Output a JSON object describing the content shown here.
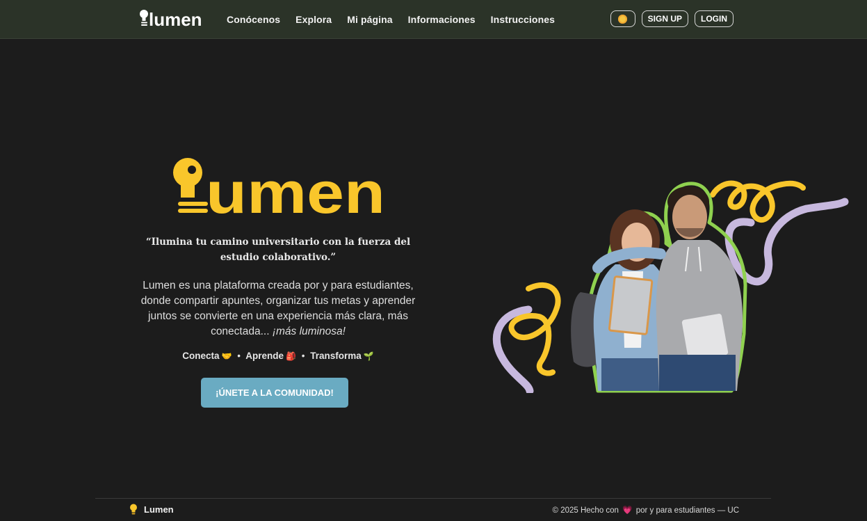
{
  "brand": {
    "name": "lumen",
    "accent": "#f9c62b"
  },
  "nav": {
    "links": [
      "Conócenos",
      "Explora",
      "Mi página",
      "Informaciones",
      "Instrucciones"
    ],
    "theme_icon": "sun-icon",
    "signup_label": "SIGN UP",
    "login_label": "LOGIN"
  },
  "hero": {
    "quote": "“Ilumina tu camino universitario con la fuerza del estudio colaborativo.”",
    "description": "Lumen es una plataforma creada por y para estudiantes, donde compartir apuntes, organizar tus metas y aprender juntos se convierte en una experiencia más clara, más conectada... ",
    "description_em": "¡más luminosa!",
    "tagline": [
      {
        "label": "Conecta",
        "icon": "🤝"
      },
      {
        "label": "Aprende",
        "icon": "🎒"
      },
      {
        "label": "Transforma",
        "icon": "🌱"
      }
    ],
    "tagline_separator": "•",
    "cta_label": "¡ÚNETE A LA COMUNIDAD!",
    "cta_color": "#6aabc2"
  },
  "footer": {
    "brand": "Lumen",
    "copyright_prefix": "© 2025 Hecho con",
    "copyright_heart": "💗",
    "copyright_suffix": "por y para estudiantes — UC"
  }
}
